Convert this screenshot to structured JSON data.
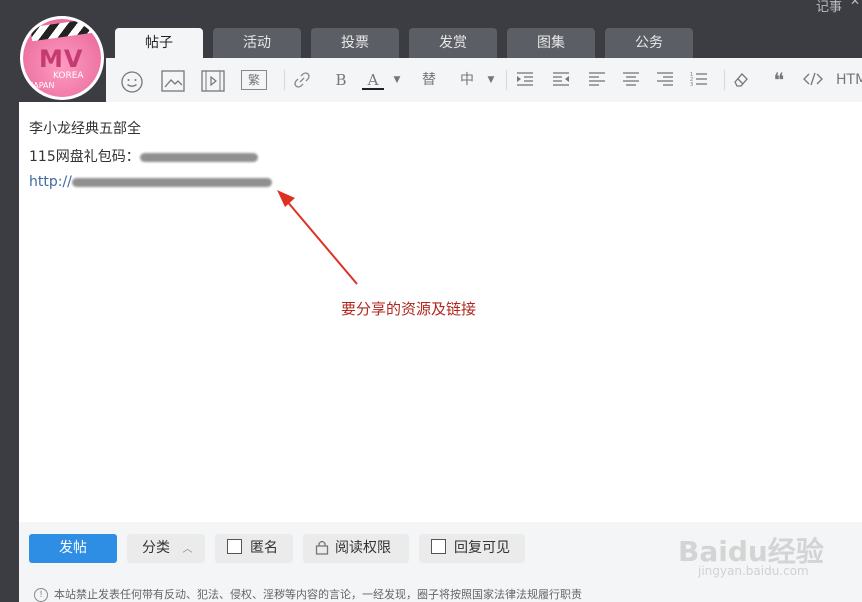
{
  "window": {
    "top_right_label": "记事",
    "close_icon": "close-icon"
  },
  "tabs": [
    {
      "label": "帖子",
      "active": true
    },
    {
      "label": "活动",
      "active": false
    },
    {
      "label": "投票",
      "active": false
    },
    {
      "label": "发赏",
      "active": false
    },
    {
      "label": "图集",
      "active": false
    },
    {
      "label": "公务",
      "active": false
    }
  ],
  "avatar": {
    "text_main": "MV",
    "text_korea": "KOREA",
    "text_japan": "JAPAN"
  },
  "toolbar": {
    "bold": "B",
    "font_color": "A",
    "replace": "替",
    "font_size": "中",
    "traditional": "繁",
    "quote": "❝",
    "html": "HTM"
  },
  "editor": {
    "line1": "李小龙经典五部全",
    "line2_prefix": "115网盘礼包码：",
    "line3_prefix": "http://",
    "annotation": "要分享的资源及链接"
  },
  "bottom": {
    "post_button": "发帖",
    "category_button": "分类",
    "anonymous_label": "匿名",
    "read_permission_label": "阅读权限",
    "reply_visible_label": "回复可见",
    "notice": "本站禁止发表任何带有反动、犯法、侵权、淫秽等内容的言论，一经发现，圈子将按照国家法律法规履行职责"
  },
  "watermark": {
    "text": "Baidu经验",
    "sub": "jingyan.baidu.com"
  },
  "colors": {
    "primary": "#2d8ee3",
    "annotation": "#b0271e",
    "link": "#3d6aa1"
  }
}
